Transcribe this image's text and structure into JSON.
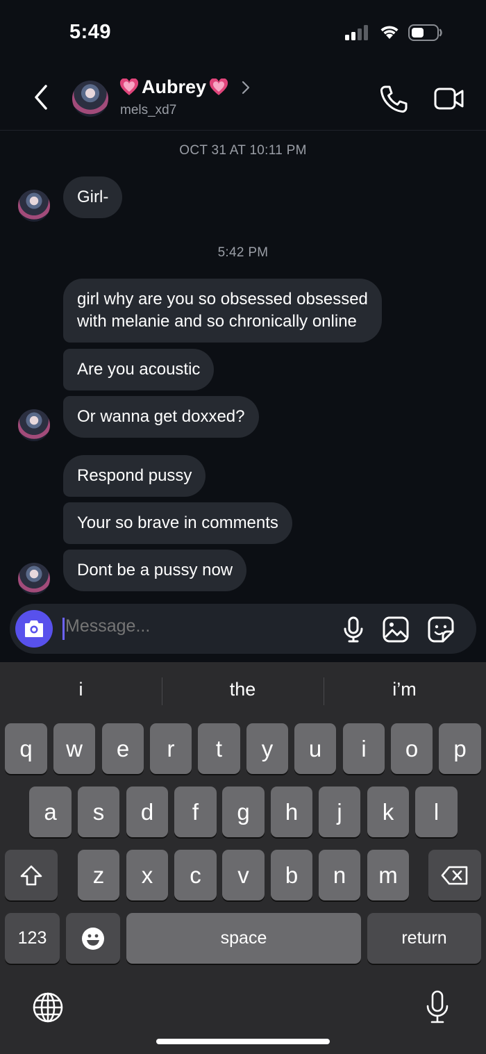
{
  "status_bar": {
    "time": "5:49"
  },
  "header": {
    "contact_name": "Aubrey",
    "username": "mels_xd7"
  },
  "messages": {
    "timestamp_1": "OCT 31 AT 10:11 PM",
    "msg_1": "Girl-",
    "timestamp_2": "5:42 PM",
    "msg_2_line1": "girl why are you so obsessed obsessed",
    "msg_2_line2": "with melanie and so chronically online",
    "msg_3": "Are you acoustic",
    "msg_4": "Or wanna get doxxed?",
    "msg_5": "Respond pussy",
    "msg_6": "Your so brave in comments",
    "msg_7": "Dont be a pussy now"
  },
  "composer": {
    "placeholder": "Message..."
  },
  "keyboard": {
    "suggestions": [
      "i",
      "the",
      "i’m"
    ],
    "row1": [
      "q",
      "w",
      "e",
      "r",
      "t",
      "y",
      "u",
      "i",
      "o",
      "p"
    ],
    "row2": [
      "a",
      "s",
      "d",
      "f",
      "g",
      "h",
      "j",
      "k",
      "l"
    ],
    "row3": [
      "z",
      "x",
      "c",
      "v",
      "b",
      "n",
      "m"
    ],
    "numbers_label": "123",
    "space_label": "space",
    "return_label": "return"
  },
  "colors": {
    "background": "#0c0f14",
    "bubble": "#262a31",
    "accent": "#5851ec",
    "heart": "#e0457b"
  }
}
